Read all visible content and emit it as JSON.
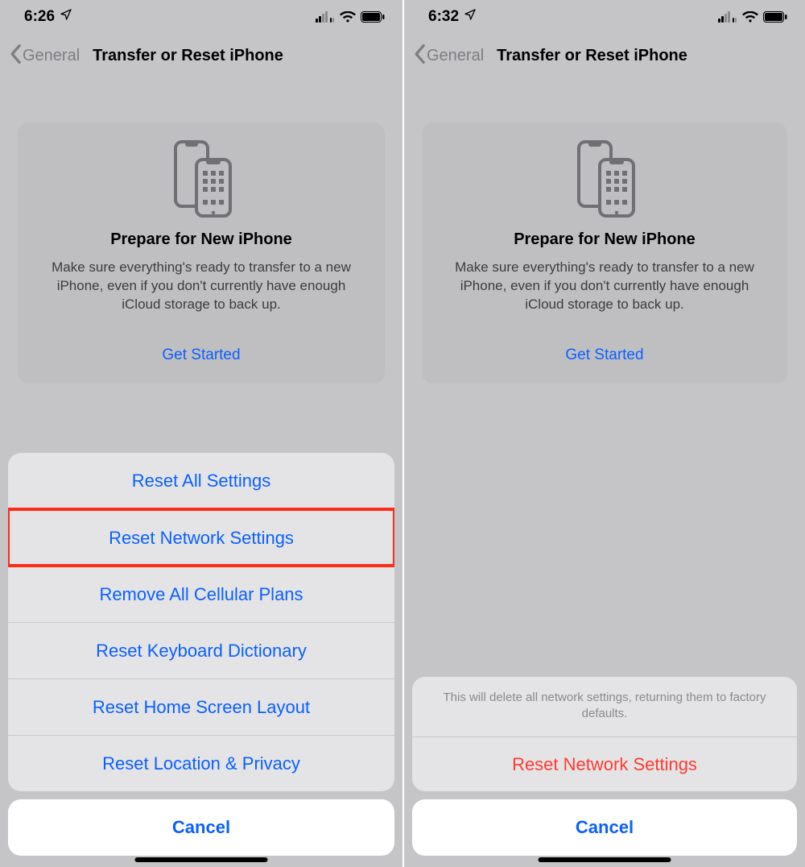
{
  "left": {
    "status": {
      "time": "6:26"
    },
    "nav": {
      "back": "General",
      "title": "Transfer or Reset iPhone"
    },
    "prepare": {
      "title": "Prepare for New iPhone",
      "desc": "Make sure everything's ready to transfer to a new iPhone, even if you don't currently have enough iCloud storage to back up.",
      "cta": "Get Started"
    },
    "sheet": {
      "items": {
        "reset_all": "Reset All Settings",
        "reset_network": "Reset Network Settings",
        "remove_cellular": "Remove All Cellular Plans",
        "reset_keyboard": "Reset Keyboard Dictionary",
        "reset_home": "Reset Home Screen Layout",
        "reset_location": "Reset Location & Privacy"
      },
      "cancel": "Cancel"
    }
  },
  "right": {
    "status": {
      "time": "6:32"
    },
    "nav": {
      "back": "General",
      "title": "Transfer or Reset iPhone"
    },
    "prepare": {
      "title": "Prepare for New iPhone",
      "desc": "Make sure everything's ready to transfer to a new iPhone, even if you don't currently have enough iCloud storage to back up.",
      "cta": "Get Started"
    },
    "confirm": {
      "message": "This will delete all network settings, returning them to factory defaults.",
      "action": "Reset Network Settings",
      "cancel": "Cancel"
    }
  }
}
